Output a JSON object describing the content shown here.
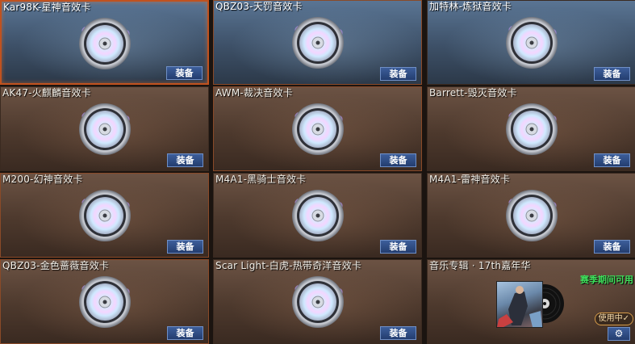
{
  "cards": [
    {
      "title": "Kar98K-星神音效卡",
      "button": "装备"
    },
    {
      "title": "QBZ03-天罚音效卡",
      "button": "装备"
    },
    {
      "title": "加特林-炼狱音效卡",
      "button": "装备"
    },
    {
      "title": "AK47-火麒麟音效卡",
      "button": "装备"
    },
    {
      "title": "AWM-裁决音效卡",
      "button": "装备"
    },
    {
      "title": "Barrett-毁灭音效卡",
      "button": "装备"
    },
    {
      "title": "M200-幻神音效卡",
      "button": "装备"
    },
    {
      "title": "M4A1-黑骑士音效卡",
      "button": "装备"
    },
    {
      "title": "M4A1-雷神音效卡",
      "button": "装备"
    },
    {
      "title": "QBZ03-金色蔷薇音效卡",
      "button": "装备"
    },
    {
      "title": "Scar Light-白虎-热带奇洋音效卡",
      "button": "装备"
    }
  ],
  "special": {
    "title": "音乐专辑 · 17th嘉年华",
    "season_label": "赛季期间可用",
    "in_use_label": "使用中✓",
    "settings_icon": "⚙"
  }
}
